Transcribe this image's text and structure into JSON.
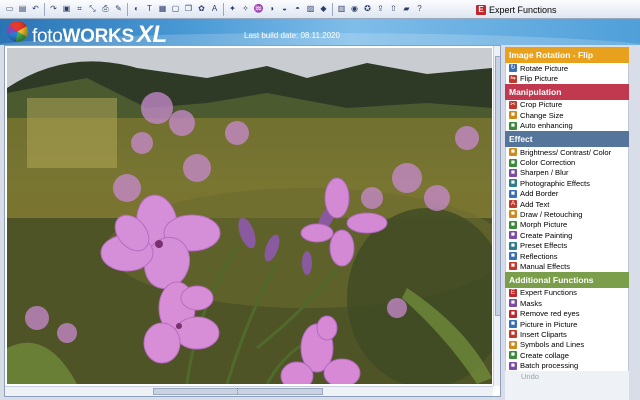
{
  "toolbar": {
    "icons": [
      "new-file",
      "open-file",
      "rotate-left",
      "rotate-right",
      "save",
      "crop",
      "resize",
      "print",
      "brush",
      "mask",
      "text",
      "image",
      "frame",
      "layers",
      "clipart",
      "font",
      "magic",
      "effects",
      "paint",
      "contrast",
      "color",
      "blur",
      "emboss",
      "sharpen",
      "frames",
      "eye",
      "stamp",
      "share",
      "upload",
      "folder",
      "help"
    ],
    "expert_label": "Expert Functions"
  },
  "banner": {
    "logo_part1": "foto",
    "logo_part2": "WORKS",
    "logo_part3": "XL",
    "build_label": "Last build date: 08.11.2020"
  },
  "colors": {
    "rotation": "#e8a11c",
    "manipulation": "#c0394e",
    "effect": "#56759b",
    "additional": "#7a9e4a"
  },
  "sections": {
    "rotation": {
      "title": "Image Rotation - Flip",
      "items": [
        {
          "label": "Rotate Picture",
          "icon": "rotate-icon"
        },
        {
          "label": "Flip Picture",
          "icon": "flip-icon"
        }
      ]
    },
    "manipulation": {
      "title": "Manipulation",
      "items": [
        {
          "label": "Crop Picture",
          "icon": "crop-icon"
        },
        {
          "label": "Change Size",
          "icon": "resize-icon"
        },
        {
          "label": "Auto enhancing",
          "icon": "enhance-icon"
        }
      ]
    },
    "effect": {
      "title": "Effect",
      "items": [
        {
          "label": "Brightness/ Contrast/ Color",
          "icon": "brightness-icon"
        },
        {
          "label": "Color Correction",
          "icon": "color-correction-icon"
        },
        {
          "label": "Sharpen / Blur",
          "icon": "sharpen-icon"
        },
        {
          "label": "Photographic Effects",
          "icon": "photo-effects-icon"
        },
        {
          "label": "Add Border",
          "icon": "border-icon"
        },
        {
          "label": "Add Text",
          "icon": "text-icon"
        },
        {
          "label": "Draw / Retouching",
          "icon": "draw-icon"
        },
        {
          "label": "Morph Picture",
          "icon": "morph-icon"
        },
        {
          "label": "Create Painting",
          "icon": "painting-icon"
        },
        {
          "label": "Preset Effects",
          "icon": "preset-icon"
        },
        {
          "label": "Reflections",
          "icon": "reflection-icon"
        },
        {
          "label": "Manual Effects",
          "icon": "manual-effects-icon"
        }
      ]
    },
    "additional": {
      "title": "Additional Functions",
      "items": [
        {
          "label": "Expert Functions",
          "icon": "expert-icon"
        },
        {
          "label": "Masks",
          "icon": "mask-icon"
        },
        {
          "label": "Remove red eyes",
          "icon": "red-eye-icon"
        },
        {
          "label": "Picture in Picture",
          "icon": "pip-icon"
        },
        {
          "label": "Insert Cliparts",
          "icon": "clipart-icon"
        },
        {
          "label": "Symbols and Lines",
          "icon": "symbols-icon"
        },
        {
          "label": "Create collage",
          "icon": "collage-icon"
        },
        {
          "label": "Batch processing",
          "icon": "batch-icon"
        }
      ]
    },
    "undo_label": "Undo"
  }
}
